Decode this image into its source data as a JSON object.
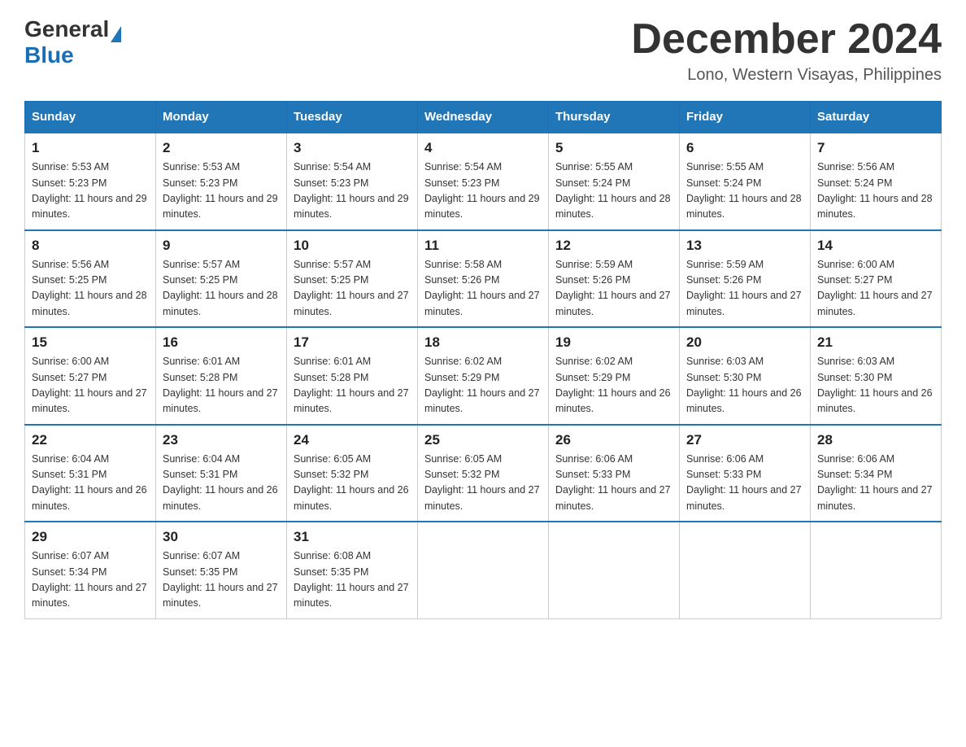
{
  "header": {
    "logo_general": "General",
    "logo_blue": "Blue",
    "month_title": "December 2024",
    "subtitle": "Lono, Western Visayas, Philippines"
  },
  "days_of_week": [
    "Sunday",
    "Monday",
    "Tuesday",
    "Wednesday",
    "Thursday",
    "Friday",
    "Saturday"
  ],
  "weeks": [
    [
      {
        "day": "1",
        "sunrise": "5:53 AM",
        "sunset": "5:23 PM",
        "daylight": "11 hours and 29 minutes."
      },
      {
        "day": "2",
        "sunrise": "5:53 AM",
        "sunset": "5:23 PM",
        "daylight": "11 hours and 29 minutes."
      },
      {
        "day": "3",
        "sunrise": "5:54 AM",
        "sunset": "5:23 PM",
        "daylight": "11 hours and 29 minutes."
      },
      {
        "day": "4",
        "sunrise": "5:54 AM",
        "sunset": "5:23 PM",
        "daylight": "11 hours and 29 minutes."
      },
      {
        "day": "5",
        "sunrise": "5:55 AM",
        "sunset": "5:24 PM",
        "daylight": "11 hours and 28 minutes."
      },
      {
        "day": "6",
        "sunrise": "5:55 AM",
        "sunset": "5:24 PM",
        "daylight": "11 hours and 28 minutes."
      },
      {
        "day": "7",
        "sunrise": "5:56 AM",
        "sunset": "5:24 PM",
        "daylight": "11 hours and 28 minutes."
      }
    ],
    [
      {
        "day": "8",
        "sunrise": "5:56 AM",
        "sunset": "5:25 PM",
        "daylight": "11 hours and 28 minutes."
      },
      {
        "day": "9",
        "sunrise": "5:57 AM",
        "sunset": "5:25 PM",
        "daylight": "11 hours and 28 minutes."
      },
      {
        "day": "10",
        "sunrise": "5:57 AM",
        "sunset": "5:25 PM",
        "daylight": "11 hours and 27 minutes."
      },
      {
        "day": "11",
        "sunrise": "5:58 AM",
        "sunset": "5:26 PM",
        "daylight": "11 hours and 27 minutes."
      },
      {
        "day": "12",
        "sunrise": "5:59 AM",
        "sunset": "5:26 PM",
        "daylight": "11 hours and 27 minutes."
      },
      {
        "day": "13",
        "sunrise": "5:59 AM",
        "sunset": "5:26 PM",
        "daylight": "11 hours and 27 minutes."
      },
      {
        "day": "14",
        "sunrise": "6:00 AM",
        "sunset": "5:27 PM",
        "daylight": "11 hours and 27 minutes."
      }
    ],
    [
      {
        "day": "15",
        "sunrise": "6:00 AM",
        "sunset": "5:27 PM",
        "daylight": "11 hours and 27 minutes."
      },
      {
        "day": "16",
        "sunrise": "6:01 AM",
        "sunset": "5:28 PM",
        "daylight": "11 hours and 27 minutes."
      },
      {
        "day": "17",
        "sunrise": "6:01 AM",
        "sunset": "5:28 PM",
        "daylight": "11 hours and 27 minutes."
      },
      {
        "day": "18",
        "sunrise": "6:02 AM",
        "sunset": "5:29 PM",
        "daylight": "11 hours and 27 minutes."
      },
      {
        "day": "19",
        "sunrise": "6:02 AM",
        "sunset": "5:29 PM",
        "daylight": "11 hours and 26 minutes."
      },
      {
        "day": "20",
        "sunrise": "6:03 AM",
        "sunset": "5:30 PM",
        "daylight": "11 hours and 26 minutes."
      },
      {
        "day": "21",
        "sunrise": "6:03 AM",
        "sunset": "5:30 PM",
        "daylight": "11 hours and 26 minutes."
      }
    ],
    [
      {
        "day": "22",
        "sunrise": "6:04 AM",
        "sunset": "5:31 PM",
        "daylight": "11 hours and 26 minutes."
      },
      {
        "day": "23",
        "sunrise": "6:04 AM",
        "sunset": "5:31 PM",
        "daylight": "11 hours and 26 minutes."
      },
      {
        "day": "24",
        "sunrise": "6:05 AM",
        "sunset": "5:32 PM",
        "daylight": "11 hours and 26 minutes."
      },
      {
        "day": "25",
        "sunrise": "6:05 AM",
        "sunset": "5:32 PM",
        "daylight": "11 hours and 27 minutes."
      },
      {
        "day": "26",
        "sunrise": "6:06 AM",
        "sunset": "5:33 PM",
        "daylight": "11 hours and 27 minutes."
      },
      {
        "day": "27",
        "sunrise": "6:06 AM",
        "sunset": "5:33 PM",
        "daylight": "11 hours and 27 minutes."
      },
      {
        "day": "28",
        "sunrise": "6:06 AM",
        "sunset": "5:34 PM",
        "daylight": "11 hours and 27 minutes."
      }
    ],
    [
      {
        "day": "29",
        "sunrise": "6:07 AM",
        "sunset": "5:34 PM",
        "daylight": "11 hours and 27 minutes."
      },
      {
        "day": "30",
        "sunrise": "6:07 AM",
        "sunset": "5:35 PM",
        "daylight": "11 hours and 27 minutes."
      },
      {
        "day": "31",
        "sunrise": "6:08 AM",
        "sunset": "5:35 PM",
        "daylight": "11 hours and 27 minutes."
      },
      null,
      null,
      null,
      null
    ]
  ],
  "labels": {
    "sunrise_prefix": "Sunrise: ",
    "sunset_prefix": "Sunset: ",
    "daylight_prefix": "Daylight: "
  }
}
